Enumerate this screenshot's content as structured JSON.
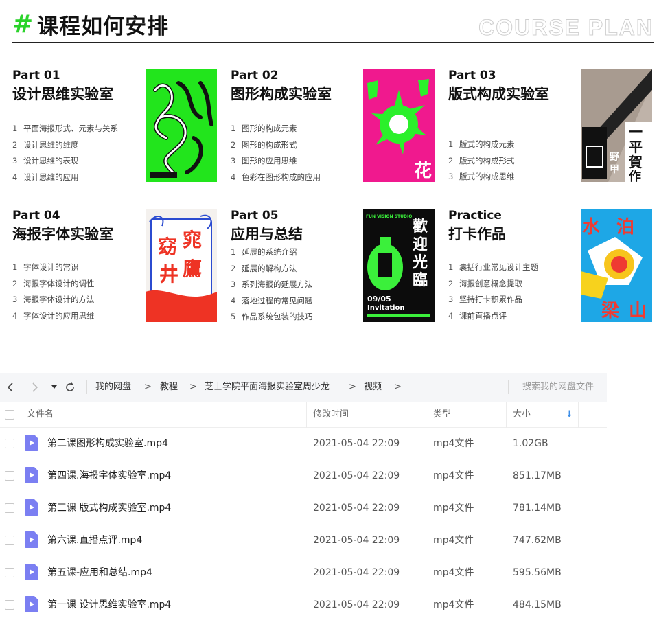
{
  "plan": {
    "hash": "#",
    "title": "课程如何安排",
    "title_en": "COURSE PLAN",
    "accent_color": "#2bd32b"
  },
  "courses": [
    {
      "part": "Part 01",
      "name": "设计思维实验室",
      "items": [
        {
          "num": "1",
          "text": "平面海报形式、元素与关系"
        },
        {
          "num": "2",
          "text": "设计思维的维度"
        },
        {
          "num": "3",
          "text": "设计思维的表现"
        },
        {
          "num": "4",
          "text": "设计思维的应用"
        }
      ]
    },
    {
      "part": "Part 02",
      "name": "图形构成实验室",
      "items": [
        {
          "num": "1",
          "text": "图形的构成元素"
        },
        {
          "num": "2",
          "text": "图形的构成形式"
        },
        {
          "num": "3",
          "text": "图形的应用思维"
        },
        {
          "num": "4",
          "text": "色彩在图形构成的应用"
        }
      ]
    },
    {
      "part": "Part 03",
      "name": "版式构成实验室",
      "items": [
        {
          "num": "1",
          "text": "版式的构成元素"
        },
        {
          "num": "2",
          "text": "版式的构成形式"
        },
        {
          "num": "3",
          "text": "版式的构成思维"
        }
      ]
    },
    {
      "part": "Part 04",
      "name": "海报字体实验室",
      "items": [
        {
          "num": "1",
          "text": "字体设计的常识"
        },
        {
          "num": "2",
          "text": "海报字体设计的调性"
        },
        {
          "num": "3",
          "text": "海报字体设计的方法"
        },
        {
          "num": "4",
          "text": "字体设计的应用思维"
        }
      ]
    },
    {
      "part": "Part 05",
      "name": "应用与总结",
      "items": [
        {
          "num": "1",
          "text": "延展的系统介绍"
        },
        {
          "num": "2",
          "text": "延展的解构方法"
        },
        {
          "num": "3",
          "text": "系列海报的延展方法"
        },
        {
          "num": "4",
          "text": "落地过程的常见问题"
        },
        {
          "num": "5",
          "text": "作品系统包装的技巧"
        }
      ]
    },
    {
      "part": "Practice",
      "name": "打卡作品",
      "items": [
        {
          "num": "1",
          "text": "囊括行业常见设计主题"
        },
        {
          "num": "2",
          "text": "海报创意概念提取"
        },
        {
          "num": "3",
          "text": "坚持打卡积累作品"
        },
        {
          "num": "4",
          "text": "课前直播点评"
        }
      ]
    }
  ],
  "posters": {
    "p2_big": "花",
    "p3_chars": [
      "一",
      "平",
      "野",
      "甲",
      "賀",
      "作"
    ],
    "p4_chars": [
      "窈",
      "窕",
      "井",
      "鷹"
    ],
    "p5_title": "歡迎光臨",
    "p5_top": "FUN VISION STUDIO",
    "p5_date": "09/05",
    "p5_sub": "Invitation",
    "p6_chars": [
      "水",
      "泊",
      "梁",
      "山"
    ]
  },
  "filemanager": {
    "nav": {
      "back": "‹",
      "forward": "›",
      "dropdown": "▾",
      "refresh": "↻"
    },
    "breadcrumbs": [
      "我的网盘",
      "教程",
      "芝士学院平面海报实验室周少龙",
      "视频"
    ],
    "crumb_sep": ">",
    "search_placeholder": "搜索我的网盘文件",
    "columns": {
      "name": "文件名",
      "time": "修改时间",
      "type": "类型",
      "size": "大小",
      "sort_icon": "↓"
    },
    "files": [
      {
        "name": "第二课图形构成实验室.mp4",
        "time": "2021-05-04 22:09",
        "type": "mp4文件",
        "size": "1.02GB"
      },
      {
        "name": "第四课.海报字体实验室.mp4",
        "time": "2021-05-04 22:09",
        "type": "mp4文件",
        "size": "851.17MB"
      },
      {
        "name": "第三课 版式构成实验室.mp4",
        "time": "2021-05-04 22:09",
        "type": "mp4文件",
        "size": "781.14MB"
      },
      {
        "name": "第六课.直播点评.mp4",
        "time": "2021-05-04 22:09",
        "type": "mp4文件",
        "size": "747.62MB"
      },
      {
        "name": "第五课-应用和总结.mp4",
        "time": "2021-05-04 22:09",
        "type": "mp4文件",
        "size": "595.56MB"
      },
      {
        "name": "第一课 设计思维实验室.mp4",
        "time": "2021-05-04 22:09",
        "type": "mp4文件",
        "size": "484.15MB"
      }
    ],
    "file_icon_color": "#7b7ff2"
  }
}
